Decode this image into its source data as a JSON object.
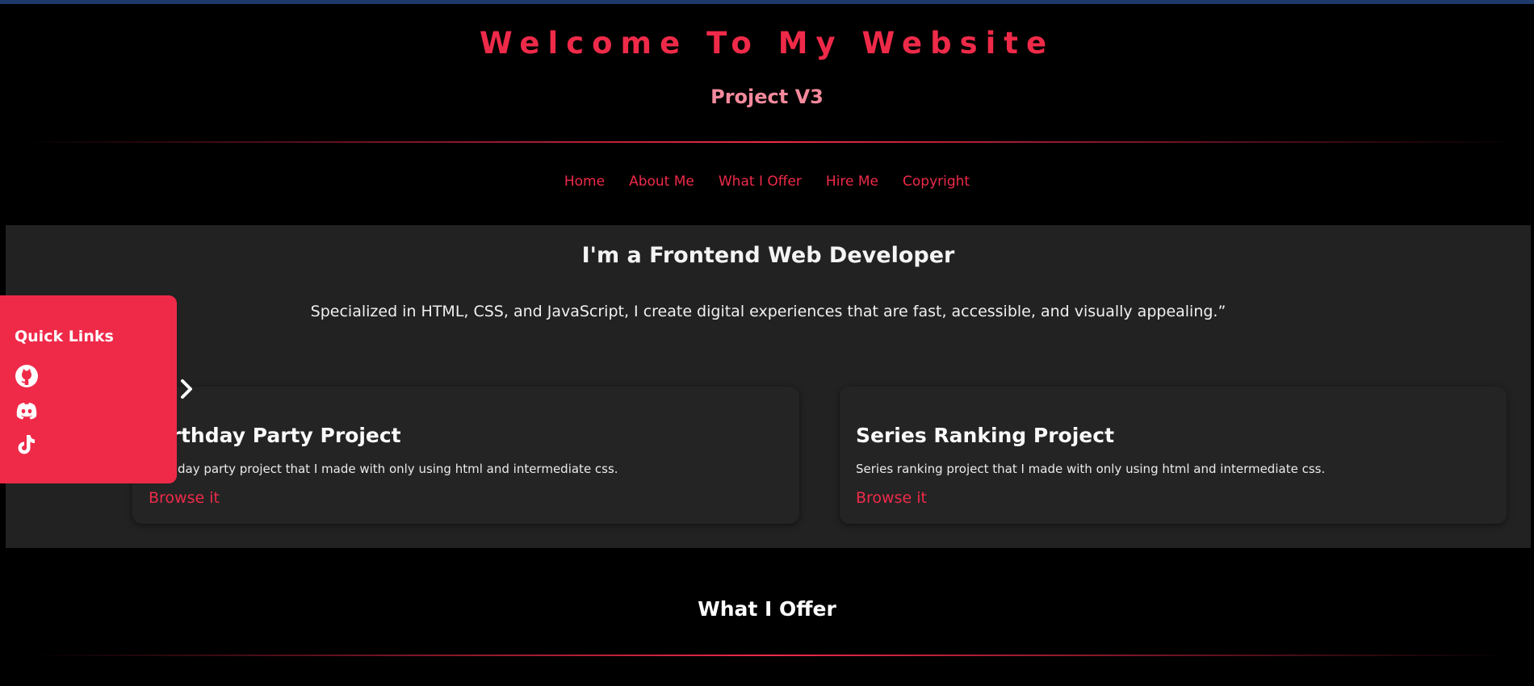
{
  "header": {
    "title": "Welcome To My Website",
    "subtitle": "Project V3"
  },
  "nav": {
    "items": [
      "Home",
      "About Me",
      "What I Offer",
      "Hire Me",
      "Copyright"
    ]
  },
  "hero": {
    "title": "I'm a Frontend Web Developer",
    "text": "Specialized in HTML, CSS, and JavaScript, I create digital experiences that are fast, accessible, and visually appealing.”"
  },
  "projects": [
    {
      "title": "Birthday Party Project",
      "description": "Birthday party project that I made with only using html and intermediate css.",
      "link": "Browse it"
    },
    {
      "title": "Series Ranking Project",
      "description": "Series ranking project that I made with only using html and intermediate css.",
      "link": "Browse it"
    }
  ],
  "quick_links": {
    "title": "Quick Links",
    "icons": [
      "github-icon",
      "discord-icon",
      "tiktok-icon"
    ]
  },
  "offer": {
    "title": "What I Offer"
  },
  "colors": {
    "background": "#000000",
    "accent": "#ef2a49",
    "subtitle": "#f38a9c",
    "panel": "#222222",
    "card": "#242424"
  }
}
